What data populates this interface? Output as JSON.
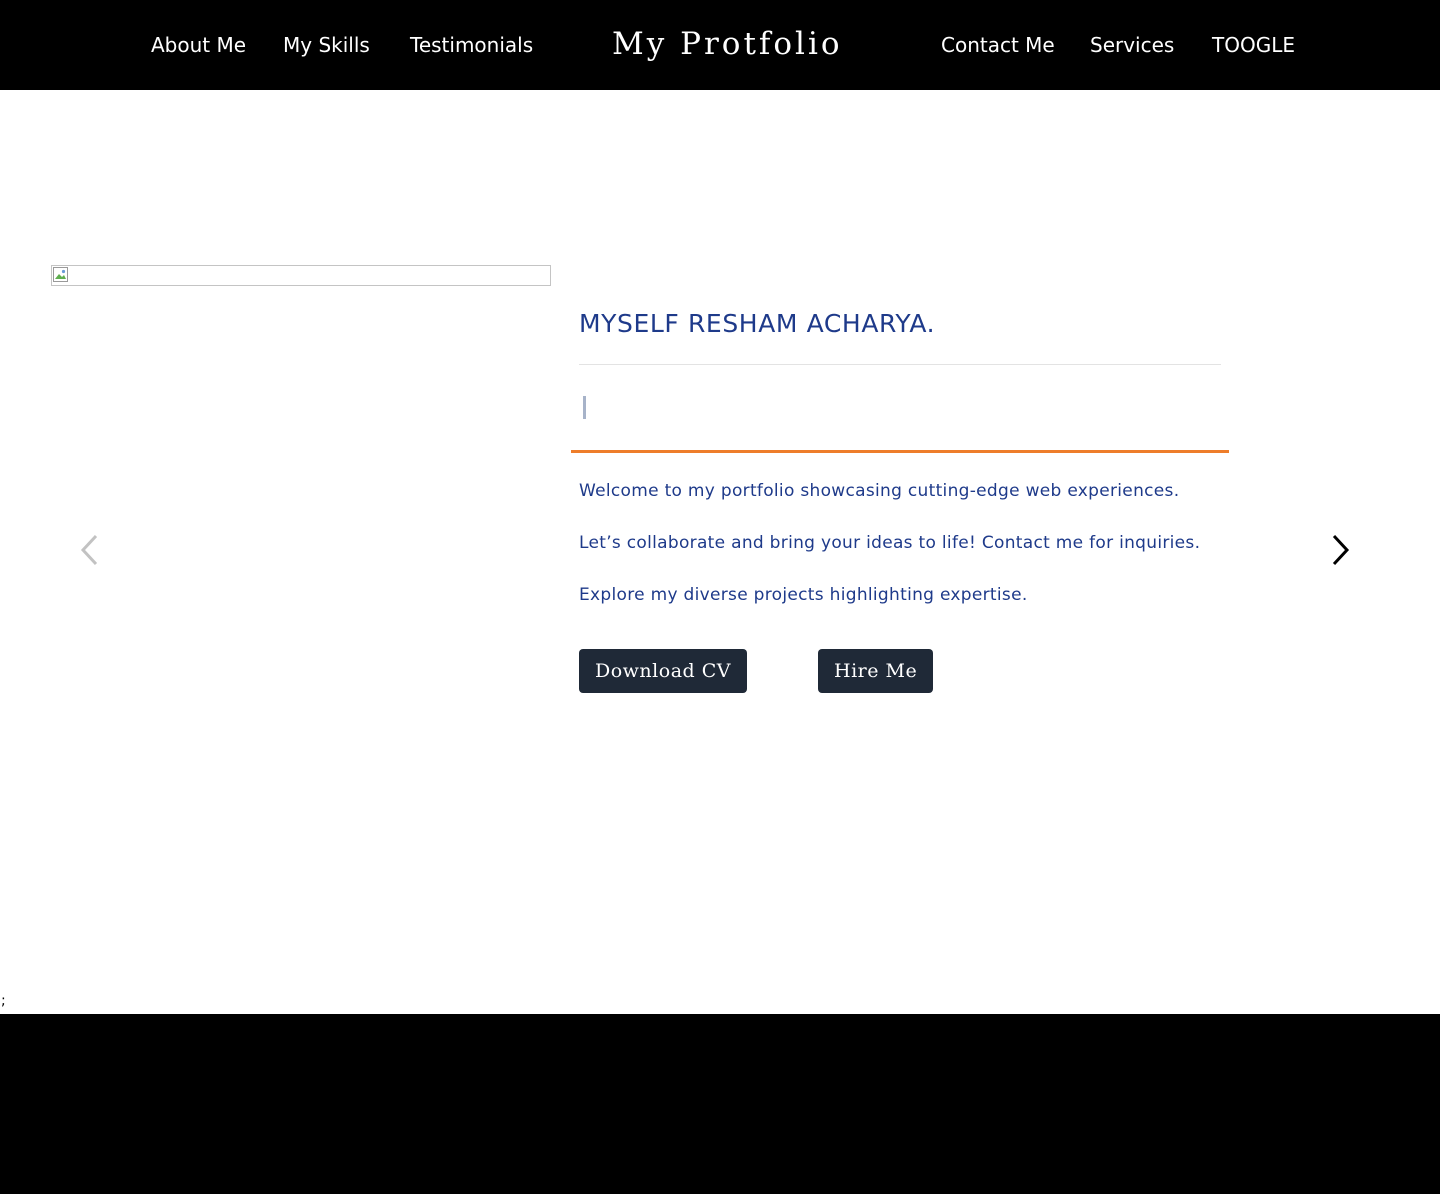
{
  "nav": {
    "left": [
      {
        "label": "About Me"
      },
      {
        "label": "My Skills"
      },
      {
        "label": "Testimonials"
      }
    ],
    "brand": "My Protfolio",
    "right": [
      {
        "label": "Contact Me"
      },
      {
        "label": "Services"
      },
      {
        "label": "TOOGLE"
      }
    ]
  },
  "hero": {
    "image_icon": "broken-image-icon",
    "headline": "MYSELF RESHAM ACHARYA.",
    "paragraphs": [
      "Welcome to my portfolio showcasing cutting-edge web experiences.",
      "Let’s collaborate and bring your ideas to life! Contact me for inquiries.",
      "Explore my diverse projects highlighting expertise."
    ],
    "buttons": {
      "download": "Download CV",
      "hire": "Hire Me"
    },
    "prev_icon": "chevron-left-icon",
    "next_icon": "chevron-right-icon"
  },
  "stray_text": ";",
  "colors": {
    "nav_bg": "#000000",
    "heading": "#1e3a8a",
    "accent": "#ee7d2a",
    "button_bg": "#1f2937",
    "footer_bg": "#000000"
  }
}
